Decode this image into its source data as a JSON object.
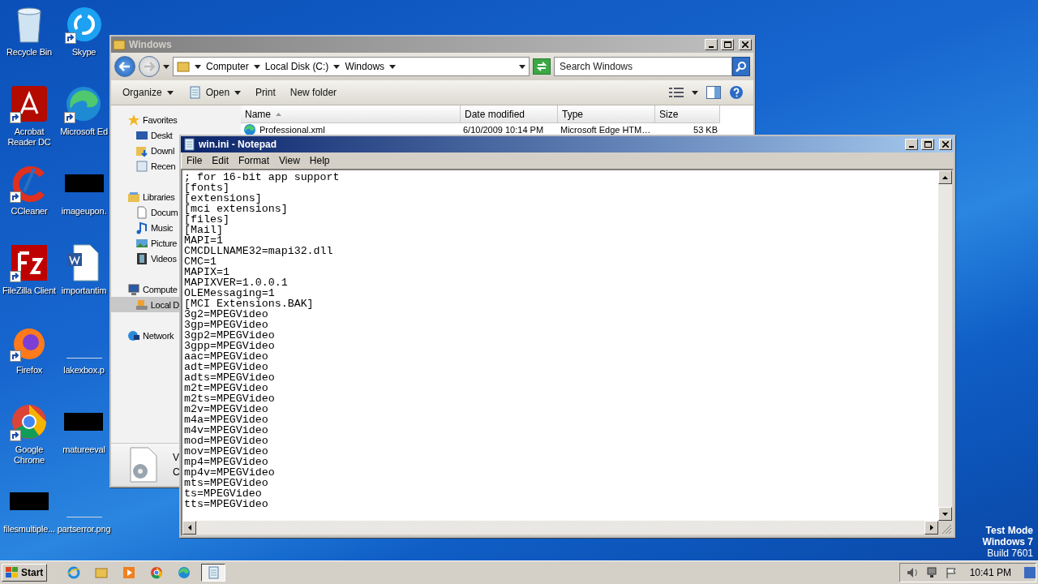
{
  "desktop_icons": [
    {
      "label": "Recycle Bin",
      "kind": "recycle",
      "shortcut": false
    },
    {
      "label": "Skype",
      "kind": "skype",
      "shortcut": true
    },
    {
      "label": "Acrobat Reader DC",
      "kind": "acrobat",
      "shortcut": true
    },
    {
      "label": "Microsoft Ed",
      "kind": "edge",
      "shortcut": true
    },
    {
      "label": "CCleaner",
      "kind": "ccleaner",
      "shortcut": true
    },
    {
      "label": "imageupon.",
      "kind": "hidden",
      "shortcut": false
    },
    {
      "label": "FileZilla Client",
      "kind": "filezilla",
      "shortcut": true
    },
    {
      "label": "importantim",
      "kind": "word",
      "shortcut": false
    },
    {
      "label": "Firefox",
      "kind": "firefox",
      "shortcut": true
    },
    {
      "label": "lakexbox.p",
      "kind": "blank",
      "shortcut": false
    },
    {
      "label": "Google Chrome",
      "kind": "chrome",
      "shortcut": true
    },
    {
      "label": "matureeval",
      "kind": "hidden",
      "shortcut": false
    },
    {
      "label": "filesmultiple...",
      "kind": "hidden",
      "shortcut": false
    },
    {
      "label": "partserror.png",
      "kind": "blank",
      "shortcut": false
    }
  ],
  "explorer": {
    "title": "Windows",
    "breadcrumb": [
      "Computer",
      "Local Disk (C:)",
      "Windows"
    ],
    "search": {
      "placeholder": "Search Windows"
    },
    "toolbar": [
      {
        "label": "Organize",
        "has_menu": true,
        "kind": "plain"
      },
      {
        "label": "Open",
        "has_menu": true,
        "kind": "notepad"
      },
      {
        "label": "Print",
        "has_menu": false,
        "kind": "plain"
      },
      {
        "label": "New folder",
        "has_menu": false,
        "kind": "plain"
      }
    ],
    "nav": [
      {
        "label": "Favorites",
        "kind": "star",
        "selected": false,
        "children": [
          {
            "label": "Deskt",
            "kind": "desktop",
            "selected": false
          },
          {
            "label": "Downl",
            "kind": "download",
            "selected": false
          },
          {
            "label": "Recen",
            "kind": "recent",
            "selected": false
          }
        ]
      },
      {
        "label": "Libraries",
        "kind": "library",
        "selected": false,
        "children": [
          {
            "label": "Docum",
            "kind": "document",
            "selected": false
          },
          {
            "label": "Music",
            "kind": "music",
            "selected": false
          },
          {
            "label": "Picture",
            "kind": "picture",
            "selected": false
          },
          {
            "label": "Videos",
            "kind": "video",
            "selected": false
          }
        ]
      },
      {
        "label": "Compute",
        "kind": "computer",
        "selected": false,
        "children": [
          {
            "label": "Local D",
            "kind": "disk",
            "selected": true
          }
        ]
      },
      {
        "label": "Network",
        "kind": "network",
        "selected": false
      }
    ],
    "columns": [
      "Name",
      "Date modified",
      "Type",
      "Size"
    ],
    "rows": [
      {
        "cells": [
          "Professional.xml",
          "6/10/2009 10:14 PM",
          "Microsoft Edge HTM…",
          "53 KB"
        ]
      }
    ],
    "details_pane": [
      "V",
      "C"
    ]
  },
  "notepad": {
    "title": "win.ini - Notepad",
    "menu": [
      "File",
      "Edit",
      "Format",
      "View",
      "Help"
    ],
    "lines": [
      "; for 16-bit app support",
      "[fonts]",
      "[extensions]",
      "[mci extensions]",
      "[files]",
      "[Mail]",
      "MAPI=1",
      "CMCDLLNAME32=mapi32.dll",
      "CMC=1",
      "MAPIX=1",
      "MAPIXVER=1.0.0.1",
      "OLEMessaging=1",
      "[MCI Extensions.BAK]",
      "3g2=MPEGVideo",
      "3gp=MPEGVideo",
      "3gp2=MPEGVideo",
      "3gpp=MPEGVideo",
      "aac=MPEGVideo",
      "adt=MPEGVideo",
      "adts=MPEGVideo",
      "m2t=MPEGVideo",
      "m2ts=MPEGVideo",
      "m2v=MPEGVideo",
      "m4a=MPEGVideo",
      "m4v=MPEGVideo",
      "mod=MPEGVideo",
      "mov=MPEGVideo",
      "mp4=MPEGVideo",
      "mp4v=MPEGVideo",
      "mts=MPEGVideo",
      "ts=MPEGVideo",
      "tts=MPEGVideo"
    ]
  },
  "os_notice": [
    "Test Mode",
    "Windows 7",
    "Build 7601"
  ],
  "taskbar": {
    "start": "Start",
    "apps": [
      {
        "kind": "ie",
        "selected": false
      },
      {
        "kind": "explorer",
        "selected": false
      },
      {
        "kind": "media",
        "selected": false
      },
      {
        "kind": "chrome",
        "selected": false
      },
      {
        "kind": "edge",
        "selected": false
      },
      {
        "kind": "notepad",
        "selected": true
      }
    ],
    "clock": "10:41 PM"
  }
}
